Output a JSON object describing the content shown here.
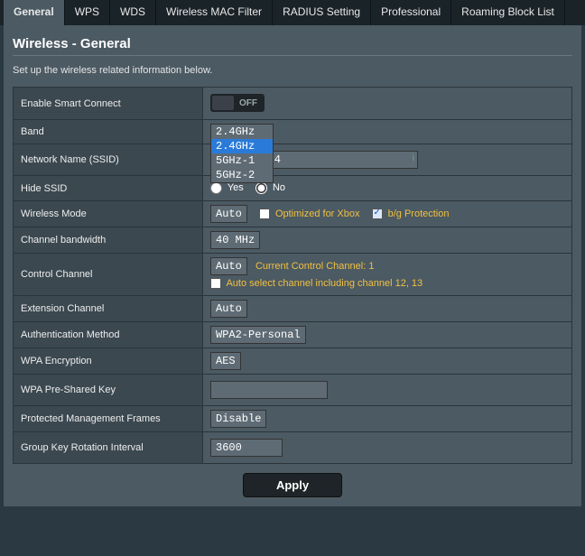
{
  "tabs": {
    "general": "General",
    "wps": "WPS",
    "wds": "WDS",
    "mac_filter": "Wireless MAC Filter",
    "radius": "RADIUS Setting",
    "professional": "Professional",
    "roaming_block": "Roaming Block List"
  },
  "page": {
    "title": "Wireless - General",
    "description": "Set up the wireless related information below."
  },
  "labels": {
    "smart_connect": "Enable Smart Connect",
    "band": "Band",
    "ssid": "Network Name (SSID)",
    "hide_ssid": "Hide SSID",
    "wireless_mode": "Wireless Mode",
    "channel_bw": "Channel bandwidth",
    "control_channel": "Control Channel",
    "ext_channel": "Extension Channel",
    "auth_method": "Authentication Method",
    "wpa_enc": "WPA Encryption",
    "wpa_psk": "WPA Pre-Shared Key",
    "pmf": "Protected Management Frames",
    "group_key": "Group Key Rotation Interval"
  },
  "values": {
    "smart_connect_toggle": "OFF",
    "band_selected": "2.4GHz",
    "band_options": [
      "2.4GHz",
      "5GHz-1",
      "5GHz-2"
    ],
    "ssid_value": "        24",
    "hide_ssid_yes": "Yes",
    "hide_ssid_no": "No",
    "hide_ssid_selected": "No",
    "wireless_mode": "Auto",
    "opt_xbox": "Optimized for Xbox",
    "bg_protection": "b/g Protection",
    "channel_bw": "40 MHz",
    "control_channel": "Auto",
    "current_control_channel": "Current Control Channel: 1",
    "auto_select_channel": "Auto select channel including channel 12, 13",
    "ext_channel": "Auto",
    "auth_method": "WPA2-Personal",
    "wpa_enc": "AES",
    "wpa_psk": "",
    "pmf": "Disable",
    "group_key": "3600"
  },
  "buttons": {
    "apply": "Apply"
  }
}
